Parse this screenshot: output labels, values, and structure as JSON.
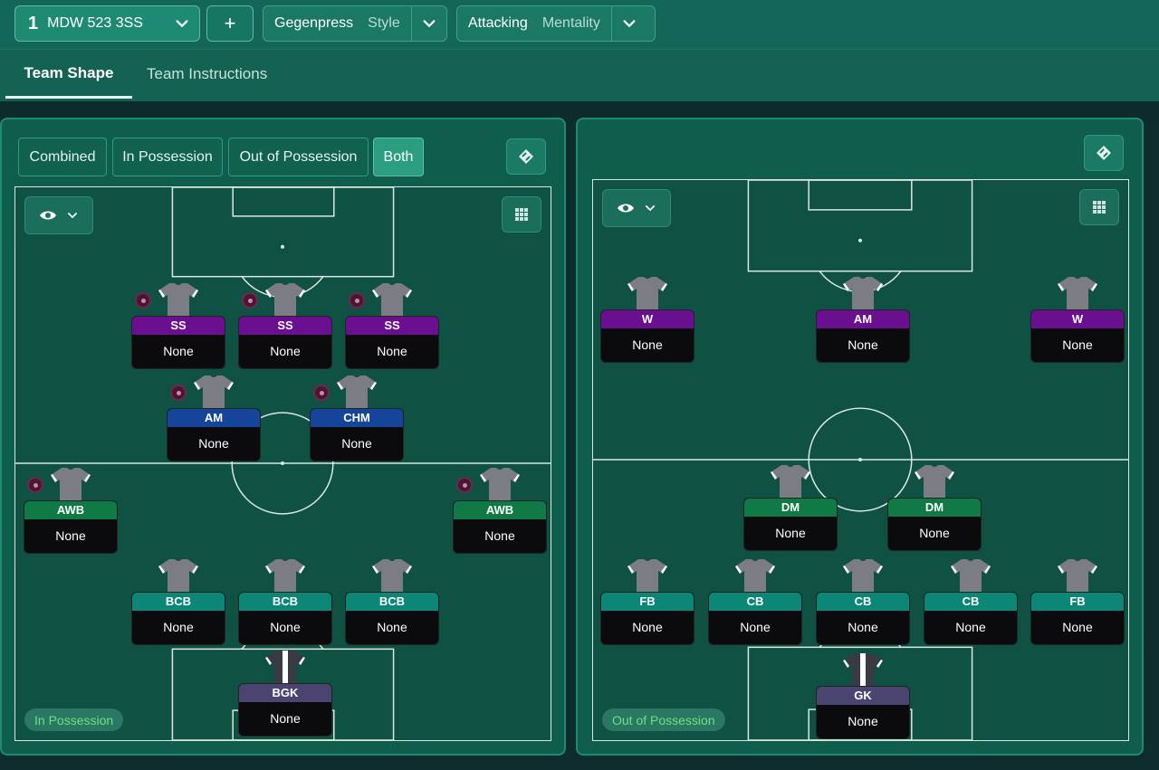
{
  "header": {
    "tactic_number": "1",
    "tactic_name": "MDW 523 3SS",
    "add_label": "+",
    "style": {
      "value": "Gegenpress",
      "label": "Style"
    },
    "mentality": {
      "value": "Attacking",
      "label": "Mentality"
    }
  },
  "tabs": {
    "team_shape": "Team Shape",
    "team_instructions": "Team Instructions"
  },
  "left_panel": {
    "segments": [
      "Combined",
      "In Possession",
      "Out of Possession",
      "Both"
    ],
    "active_segment": "Both",
    "phase_label": "In Possession",
    "players": [
      {
        "role": "SS",
        "name": "None",
        "color": "#6a0f8f"
      },
      {
        "role": "SS",
        "name": "None",
        "color": "#6a0f8f"
      },
      {
        "role": "SS",
        "name": "None",
        "color": "#6a0f8f"
      },
      {
        "role": "AM",
        "name": "None",
        "color": "#15459a"
      },
      {
        "role": "CHM",
        "name": "None",
        "color": "#15459a"
      },
      {
        "role": "AWB",
        "name": "None",
        "color": "#0f7a45"
      },
      {
        "role": "AWB",
        "name": "None",
        "color": "#0f7a45"
      },
      {
        "role": "BCB",
        "name": "None",
        "color": "#0c8676"
      },
      {
        "role": "BCB",
        "name": "None",
        "color": "#0c8676"
      },
      {
        "role": "BCB",
        "name": "None",
        "color": "#0c8676"
      },
      {
        "role": "BGK",
        "name": "None",
        "color": "#4a4470"
      }
    ]
  },
  "right_panel": {
    "phase_label": "Out of Possession",
    "players": [
      {
        "role": "W",
        "name": "None",
        "color": "#6a0f8f"
      },
      {
        "role": "AM",
        "name": "None",
        "color": "#6a0f8f"
      },
      {
        "role": "W",
        "name": "None",
        "color": "#6a0f8f"
      },
      {
        "role": "DM",
        "name": "None",
        "color": "#0f7a45"
      },
      {
        "role": "DM",
        "name": "None",
        "color": "#0f7a45"
      },
      {
        "role": "FB",
        "name": "None",
        "color": "#0c8676"
      },
      {
        "role": "CB",
        "name": "None",
        "color": "#0c8676"
      },
      {
        "role": "CB",
        "name": "None",
        "color": "#0c8676"
      },
      {
        "role": "CB",
        "name": "None",
        "color": "#0c8676"
      },
      {
        "role": "FB",
        "name": "None",
        "color": "#0c8676"
      },
      {
        "role": "GK",
        "name": "None",
        "color": "#4a4470"
      }
    ]
  },
  "icons": [
    "chevron-down-icon",
    "eye-icon",
    "grid-icon",
    "swap-icon",
    "player-shirt-icon",
    "player-instruction-dot-icon"
  ],
  "colors": {
    "accent": "#1e8a74",
    "pitch": "#0f5142",
    "phase_text": "#6fe07a"
  }
}
